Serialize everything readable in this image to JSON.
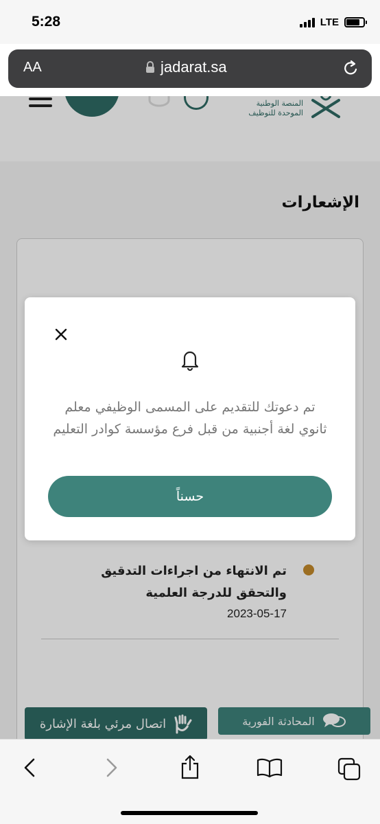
{
  "status_bar": {
    "time": "5:28",
    "network": "LTE"
  },
  "browser": {
    "text_size_label": "AA",
    "url": "jadarat.sa"
  },
  "site_header": {
    "brand_line1": "المنصة الوطنية",
    "brand_line2": "الموحدة للتوظيف"
  },
  "page": {
    "title": "الإشعارات",
    "notification": {
      "text": "تم الانتهاء من اجراءات التدقيق والتحقق للدرجة العلمية",
      "date": "2023-05-17"
    },
    "chat_button": "المحادثة الفورية",
    "sign_language_button": "اتصال مرئي بلغة الإشارة"
  },
  "modal": {
    "message": "تم دعوتك للتقديم على المسمى الوظيفي معلم ثانوي لغة أجنبية من قبل فرع مؤسسة كوادر التعليم",
    "ok_button": "حسناً"
  },
  "colors": {
    "primary": "#3e837b",
    "dark_primary": "#2f6b64",
    "dot": "#c48a2b"
  }
}
